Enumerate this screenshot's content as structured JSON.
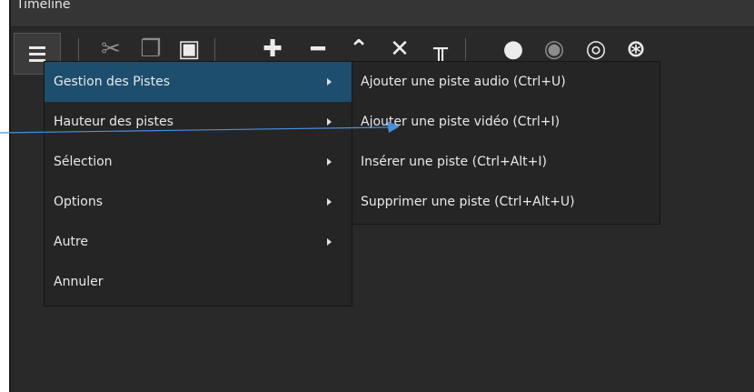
{
  "window": {
    "title": "Timeline"
  },
  "toolbar": {
    "buttons": [
      {
        "icon": "menu-icon"
      },
      {
        "icon": "cut-icon"
      },
      {
        "icon": "copy-icon"
      },
      {
        "icon": "paste-icon"
      },
      {
        "icon": "plus-icon"
      },
      {
        "icon": "minus-icon"
      },
      {
        "icon": "chevron-up-icon"
      },
      {
        "icon": "x-icon"
      },
      {
        "icon": "split-icon"
      },
      {
        "icon": "snap-icon"
      },
      {
        "icon": "scrub-icon"
      },
      {
        "icon": "ripple-icon"
      },
      {
        "icon": "ripple-all-icon"
      }
    ]
  },
  "menu": {
    "items": [
      {
        "label": "Gestion des Pistes",
        "has_submenu": true,
        "active": true
      },
      {
        "label": "Hauteur des pistes",
        "has_submenu": true
      },
      {
        "label": "Sélection",
        "has_submenu": true
      },
      {
        "label": "Options",
        "has_submenu": true
      },
      {
        "label": "Autre",
        "has_submenu": true
      },
      {
        "label": "Annuler",
        "has_submenu": false
      }
    ]
  },
  "submenu": {
    "items": [
      {
        "label": "Ajouter une piste audio (Ctrl+U)"
      },
      {
        "label": "Ajouter une piste vidéo (Ctrl+I)"
      },
      {
        "label": "Insérer une piste (Ctrl+Alt+I)"
      },
      {
        "label": "Supprimer une piste (Ctrl+Alt+U)"
      }
    ]
  },
  "colors": {
    "panel_bg": "#292929",
    "menu_bg": "#252525",
    "highlight": "#1d4e6e",
    "annotation": "#4a90d9"
  }
}
